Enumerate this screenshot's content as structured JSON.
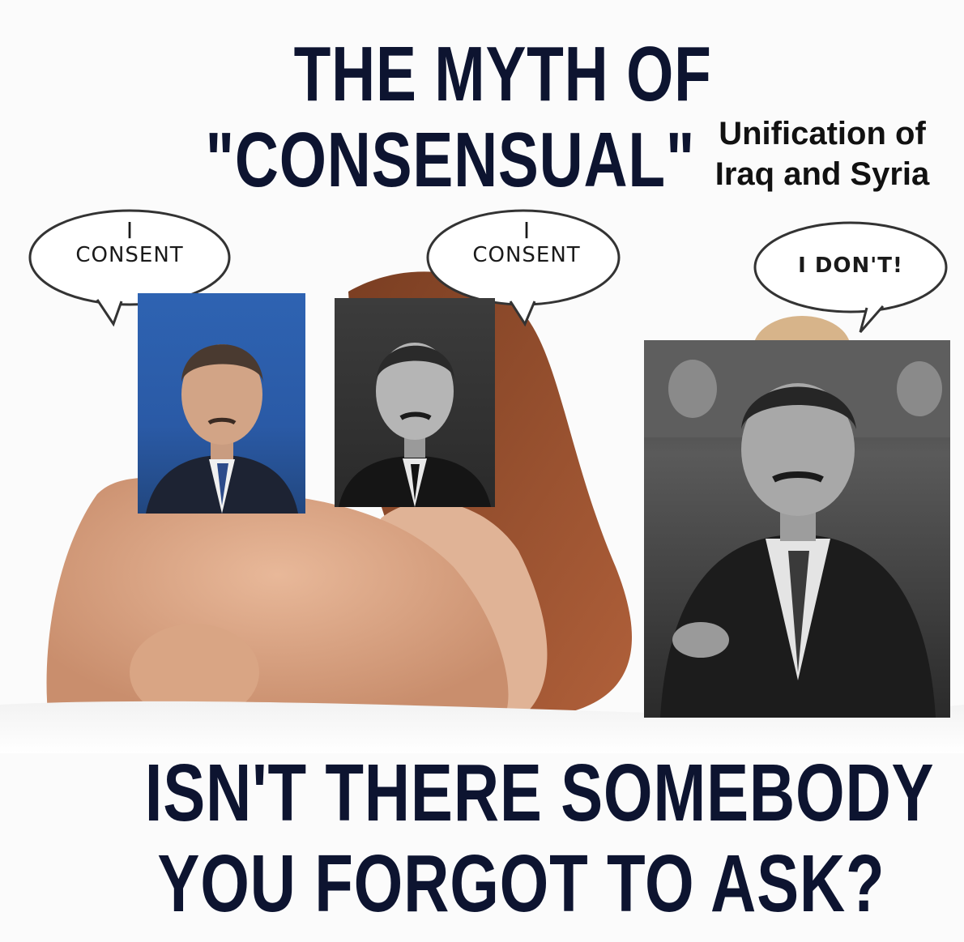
{
  "title": {
    "line1": "THE MYTH OF",
    "line2": "\"CONSENSUAL\""
  },
  "caption": {
    "line1": "Unification of",
    "line2": "Iraq and Syria"
  },
  "bubbles": [
    {
      "line1": "I",
      "line2": "CONSENT"
    },
    {
      "line1": "I",
      "line2": "CONSENT"
    },
    {
      "text": "I DON'T!"
    }
  ],
  "bottom": {
    "line1": "ISN'T THERE SOMEBODY",
    "line2": "YOU FORGOT TO ASK?"
  },
  "colors": {
    "headline": "#0d1430",
    "caption": "#111111",
    "background": "#fbfbfb"
  }
}
